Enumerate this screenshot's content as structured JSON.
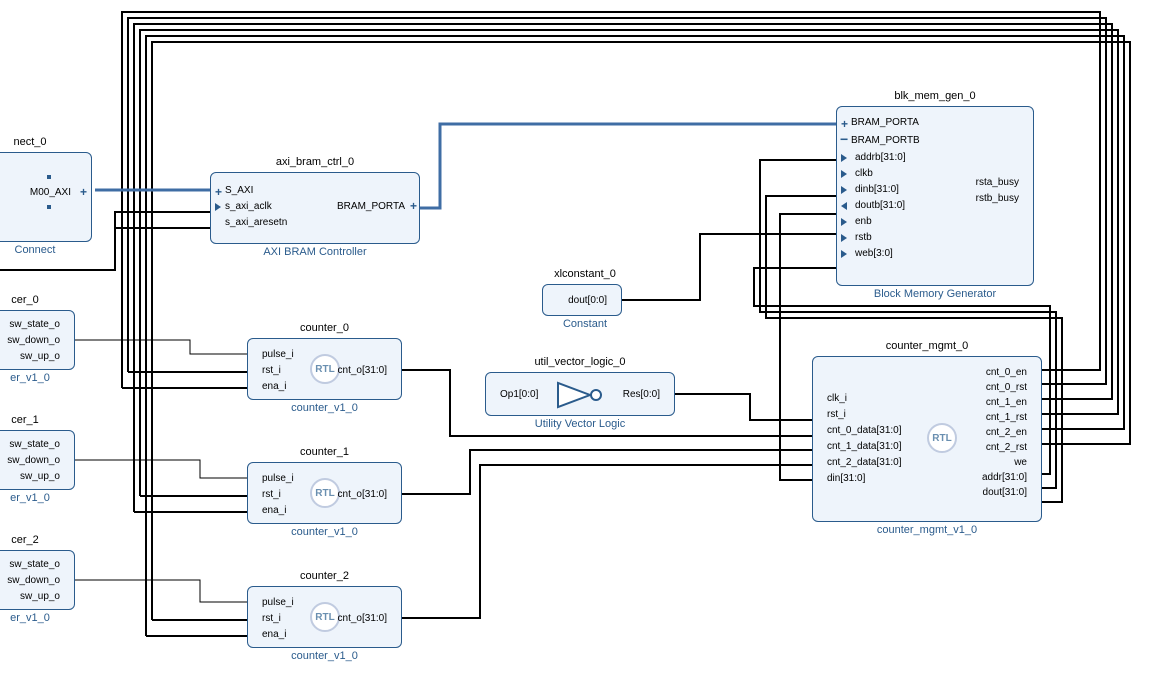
{
  "blocks": {
    "interconnect": {
      "title": "nect_0",
      "footer": "Connect",
      "ports": {
        "m00_axi": "M00_AXI"
      }
    },
    "axi_bram_ctrl": {
      "title": "axi_bram_ctrl_0",
      "footer": "AXI BRAM Controller",
      "ports": {
        "s_axi": "S_AXI",
        "s_axi_aclk": "s_axi_aclk",
        "s_axi_aresetn": "s_axi_aresetn",
        "bram_porta": "BRAM_PORTA"
      }
    },
    "counter0": {
      "title": "counter_0",
      "footer": "counter_v1_0",
      "ports": {
        "pulse_i": "pulse_i",
        "rst_i": "rst_i",
        "ena_i": "ena_i",
        "cnt_o": "cnt_o[31:0]"
      }
    },
    "counter1": {
      "title": "counter_1",
      "footer": "counter_v1_0",
      "ports": {
        "pulse_i": "pulse_i",
        "rst_i": "rst_i",
        "ena_i": "ena_i",
        "cnt_o": "cnt_o[31:0]"
      }
    },
    "counter2": {
      "title": "counter_2",
      "footer": "counter_v1_0",
      "ports": {
        "pulse_i": "pulse_i",
        "rst_i": "rst_i",
        "ena_i": "ena_i",
        "cnt_o": "cnt_o[31:0]"
      }
    },
    "debouncer0": {
      "title": "cer_0",
      "footer": "er_v1_0",
      "ports": {
        "sw_state_o": "sw_state_o",
        "sw_down_o": "sw_down_o",
        "sw_up_o": "sw_up_o"
      }
    },
    "debouncer1": {
      "title": "cer_1",
      "footer": "er_v1_0",
      "ports": {
        "sw_state_o": "sw_state_o",
        "sw_down_o": "sw_down_o",
        "sw_up_o": "sw_up_o"
      }
    },
    "debouncer2": {
      "title": "cer_2",
      "footer": "er_v1_0",
      "ports": {
        "sw_state_o": "sw_state_o",
        "sw_down_o": "sw_down_o",
        "sw_up_o": "sw_up_o"
      }
    },
    "xlconstant": {
      "title": "xlconstant_0",
      "footer": "Constant",
      "ports": {
        "dout": "dout[0:0]"
      }
    },
    "util_vector_logic": {
      "title": "util_vector_logic_0",
      "footer": "Utility Vector Logic",
      "ports": {
        "op1": "Op1[0:0]",
        "res": "Res[0:0]"
      }
    },
    "blk_mem_gen": {
      "title": "blk_mem_gen_0",
      "footer": "Block Memory Generator",
      "ports": {
        "bram_porta": "BRAM_PORTA",
        "bram_portb": "BRAM_PORTB",
        "addrb": "addrb[31:0]",
        "clkb": "clkb",
        "dinb": "dinb[31:0]",
        "doutb": "doutb[31:0]",
        "enb": "enb",
        "rstb": "rstb",
        "web": "web[3:0]",
        "rsta_busy": "rsta_busy",
        "rstb_busy": "rstb_busy"
      }
    },
    "counter_mgmt": {
      "title": "counter_mgmt_0",
      "footer": "counter_mgmt_v1_0",
      "ports": {
        "clk_i": "clk_i",
        "rst_i": "rst_i",
        "cnt_0_data": "cnt_0_data[31:0]",
        "cnt_1_data": "cnt_1_data[31:0]",
        "cnt_2_data": "cnt_2_data[31:0]",
        "din": "din[31:0]",
        "cnt_0_en": "cnt_0_en",
        "cnt_0_rst": "cnt_0_rst",
        "cnt_1_en": "cnt_1_en",
        "cnt_1_rst": "cnt_1_rst",
        "cnt_2_en": "cnt_2_en",
        "cnt_2_rst": "cnt_2_rst",
        "we": "we",
        "addr": "addr[31:0]",
        "dout": "dout[31:0]"
      }
    }
  }
}
